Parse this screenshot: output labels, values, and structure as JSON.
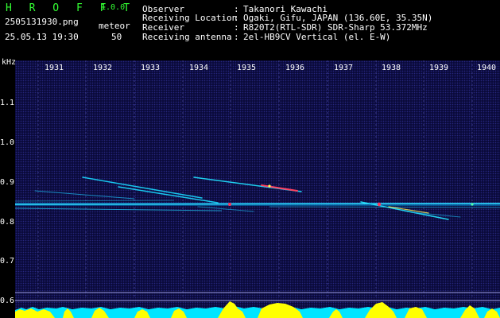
{
  "header": {
    "app_title": "H R O F F T",
    "app_version": "1.0.0",
    "file_name": "2505131930.png",
    "timestamp": "25.05.13 19:30",
    "meteor_label": "meteor",
    "meteor_count": "50"
  },
  "info": [
    {
      "label": "Observer",
      "value": "Takanori Kawachi"
    },
    {
      "label": "Receiving Location",
      "value": "Ogaki, Gifu, JAPAN (136.60E, 35.35N)"
    },
    {
      "label": "Receiver",
      "value": "R820T2(RTL-SDR) SDR-Sharp 53.372MHz"
    },
    {
      "label": "Receiving antenna",
      "value": "2el-HB9CV Vertical (el. E-W)"
    }
  ],
  "axis": {
    "unit": "kHz",
    "y_labels": [
      "1.1",
      "1.0",
      "0.9",
      "0.8",
      "0.7",
      "0.6"
    ],
    "time_labels": [
      "1931",
      "1932",
      "1933",
      "1934",
      "1935",
      "1936",
      "1937",
      "1938",
      "1939",
      "1940"
    ]
  },
  "colors": {
    "header_green": "#33ff33",
    "background_blue": "#0a0a3a",
    "signal_cyan": "#00e5ff",
    "level_yellow": "#ffff00"
  }
}
